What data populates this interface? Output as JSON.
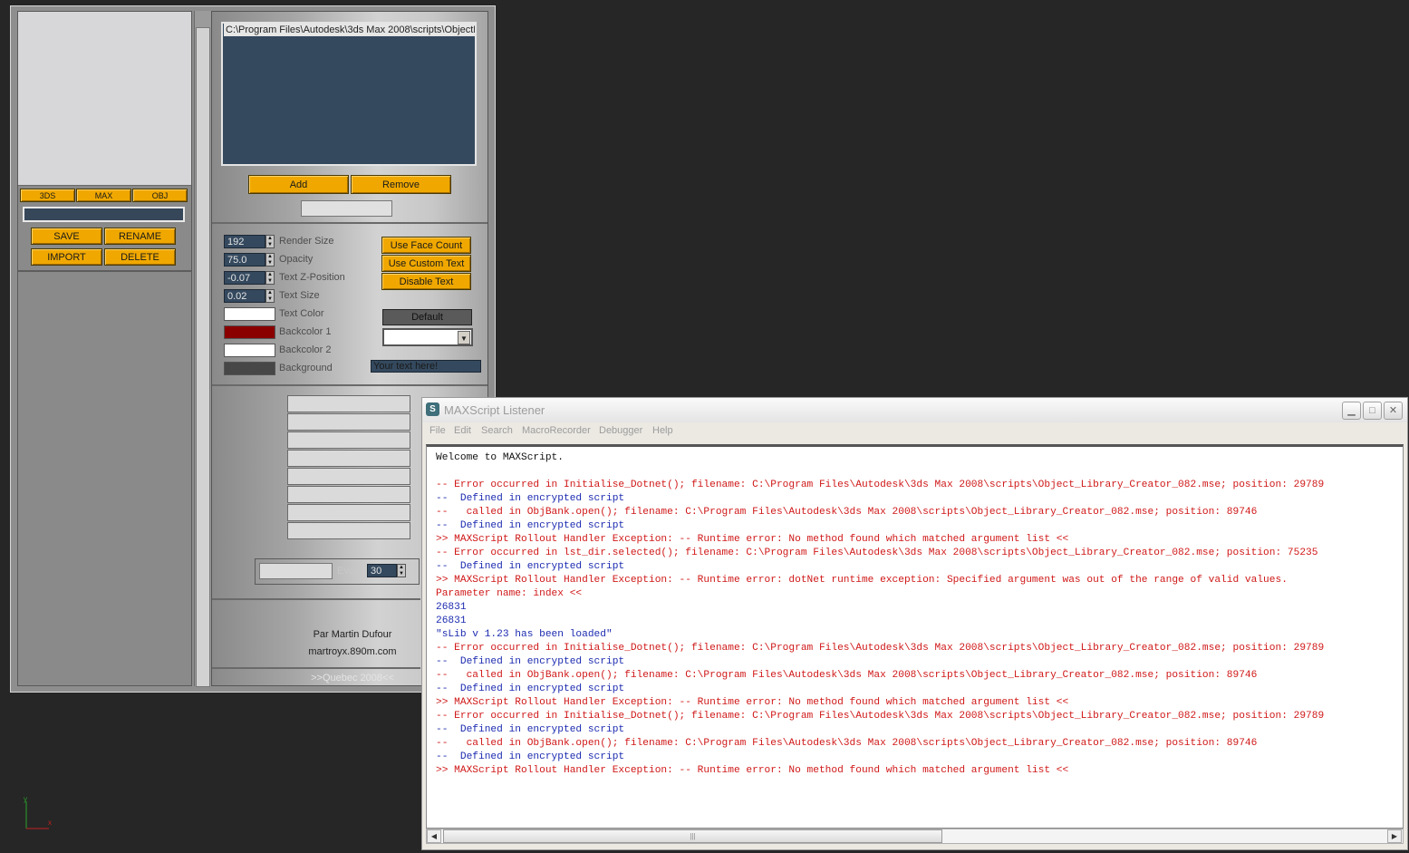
{
  "tool": {
    "format_buttons": [
      "3DS",
      "MAX",
      "OBJ"
    ],
    "action_buttons": [
      "SAVE",
      "RENAME",
      "IMPORT",
      "DELETE"
    ],
    "directory_path": "C:\\Program Files\\Autodesk\\3ds Max 2008\\scripts\\ObjectL",
    "add_label": "Add",
    "remove_label": "Remove",
    "params": [
      {
        "value": "192",
        "label": "Render Size"
      },
      {
        "value": "75.0",
        "label": "Opacity"
      },
      {
        "value": "-0.07",
        "label": "Text Z-Position"
      },
      {
        "value": "0.02",
        "label": "Text Size"
      }
    ],
    "colors": [
      {
        "label": "Text Color",
        "color": "#ffffff"
      },
      {
        "label": "Backcolor 1",
        "color": "#8a0000"
      },
      {
        "label": "Backcolor 2",
        "color": "#ffffff"
      },
      {
        "label": "Background",
        "color": "#474747"
      }
    ],
    "text_buttons": [
      "Use Face Count",
      "Use Custom Text",
      "Disable Text"
    ],
    "default_label": "Default",
    "text_field_value": "Your text here!",
    "every_label": "Every",
    "every_value": "30",
    "credit_author": "Par Martin Dufour",
    "credit_site": "martroyx.890m.com",
    "credit_place": ">>Quebec 2008<<"
  },
  "listener": {
    "title": "MAXScript Listener",
    "menu": [
      "File",
      "Edit",
      "Search",
      "MacroRecorder",
      "Debugger",
      "Help"
    ],
    "lines": [
      {
        "t": "Welcome to MAXScript.",
        "c": "black"
      },
      {
        "t": "",
        "c": "black"
      },
      {
        "t": "-- Error occurred in Initialise_Dotnet(); filename: C:\\Program Files\\Autodesk\\3ds Max 2008\\scripts\\Object_Library_Creator_082.mse; position: 29789",
        "c": "red"
      },
      {
        "t": "--  Defined in encrypted script",
        "c": "blue"
      },
      {
        "t": "--   called in ObjBank.open(); filename: C:\\Program Files\\Autodesk\\3ds Max 2008\\scripts\\Object_Library_Creator_082.mse; position: 89746",
        "c": "red"
      },
      {
        "t": "--  Defined in encrypted script",
        "c": "blue"
      },
      {
        "t": ">> MAXScript Rollout Handler Exception: -- Runtime error: No method found which matched argument list <<",
        "c": "red"
      },
      {
        "t": "-- Error occurred in lst_dir.selected(); filename: C:\\Program Files\\Autodesk\\3ds Max 2008\\scripts\\Object_Library_Creator_082.mse; position: 75235",
        "c": "red"
      },
      {
        "t": "--  Defined in encrypted script",
        "c": "blue"
      },
      {
        "t": ">> MAXScript Rollout Handler Exception: -- Runtime error: dotNet runtime exception: Specified argument was out of the range of valid values.",
        "c": "red"
      },
      {
        "t": "Parameter name: index <<",
        "c": "red"
      },
      {
        "t": "26831",
        "c": "blue"
      },
      {
        "t": "26831",
        "c": "blue"
      },
      {
        "t": "\"sLib v 1.23 has been loaded\"",
        "c": "blue"
      },
      {
        "t": "-- Error occurred in Initialise_Dotnet(); filename: C:\\Program Files\\Autodesk\\3ds Max 2008\\scripts\\Object_Library_Creator_082.mse; position: 29789",
        "c": "red"
      },
      {
        "t": "--  Defined in encrypted script",
        "c": "blue"
      },
      {
        "t": "--   called in ObjBank.open(); filename: C:\\Program Files\\Autodesk\\3ds Max 2008\\scripts\\Object_Library_Creator_082.mse; position: 89746",
        "c": "red"
      },
      {
        "t": "--  Defined in encrypted script",
        "c": "blue"
      },
      {
        "t": ">> MAXScript Rollout Handler Exception: -- Runtime error: No method found which matched argument list <<",
        "c": "red"
      },
      {
        "t": "-- Error occurred in Initialise_Dotnet(); filename: C:\\Program Files\\Autodesk\\3ds Max 2008\\scripts\\Object_Library_Creator_082.mse; position: 29789",
        "c": "red"
      },
      {
        "t": "--  Defined in encrypted script",
        "c": "blue"
      },
      {
        "t": "--   called in ObjBank.open(); filename: C:\\Program Files\\Autodesk\\3ds Max 2008\\scripts\\Object_Library_Creator_082.mse; position: 89746",
        "c": "red"
      },
      {
        "t": "--  Defined in encrypted script",
        "c": "blue"
      },
      {
        "t": ">> MAXScript Rollout Handler Exception: -- Runtime error: No method found which matched argument list <<",
        "c": "red"
      }
    ]
  },
  "axis": {
    "y": "y",
    "x": "x"
  },
  "icons": {
    "app": "maxscript-icon",
    "minimize": "minimize-icon",
    "maximize": "maximize-icon",
    "close": "close-icon"
  }
}
